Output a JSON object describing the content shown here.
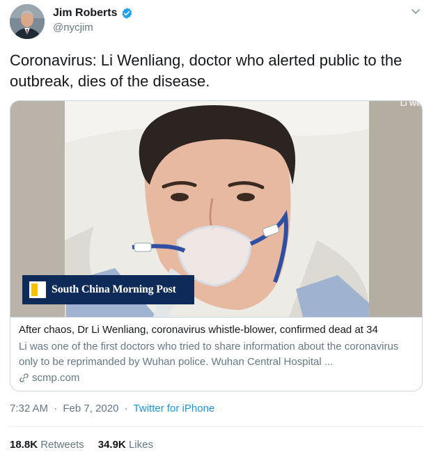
{
  "author": {
    "name": "Jim Roberts",
    "handle": "@nycjim",
    "verified": true,
    "avatar_icon": "avatar-photo"
  },
  "tweet": {
    "text": "Coronavirus: Li Wenliang, doctor who alerted public to the outbreak, dies of the disease."
  },
  "card": {
    "image_watermark": "Li We",
    "logo_text": "South China Morning Post",
    "title": "After chaos, Dr Li Wenliang, coronavirus whistle-blower, confirmed dead at 34",
    "description": "Li was one of the first doctors who tried to share information about the coronavirus only to be reprimanded by Wuhan police. Wuhan Central Hospital ...",
    "domain": "scmp.com",
    "domain_icon": "link-icon"
  },
  "meta": {
    "time": "7:32 AM",
    "separator": "·",
    "date": "Feb 7, 2020",
    "source": "Twitter for iPhone"
  },
  "stats": {
    "retweets_count": "18.8K",
    "retweets_label": "Retweets",
    "likes_count": "34.9K",
    "likes_label": "Likes"
  },
  "colors": {
    "accent": "#1b95e0",
    "secondary_text": "#657786",
    "verified_badge": "#1da1f2",
    "scmp_navy": "#0d2a58",
    "scmp_yellow": "#f2c200"
  }
}
